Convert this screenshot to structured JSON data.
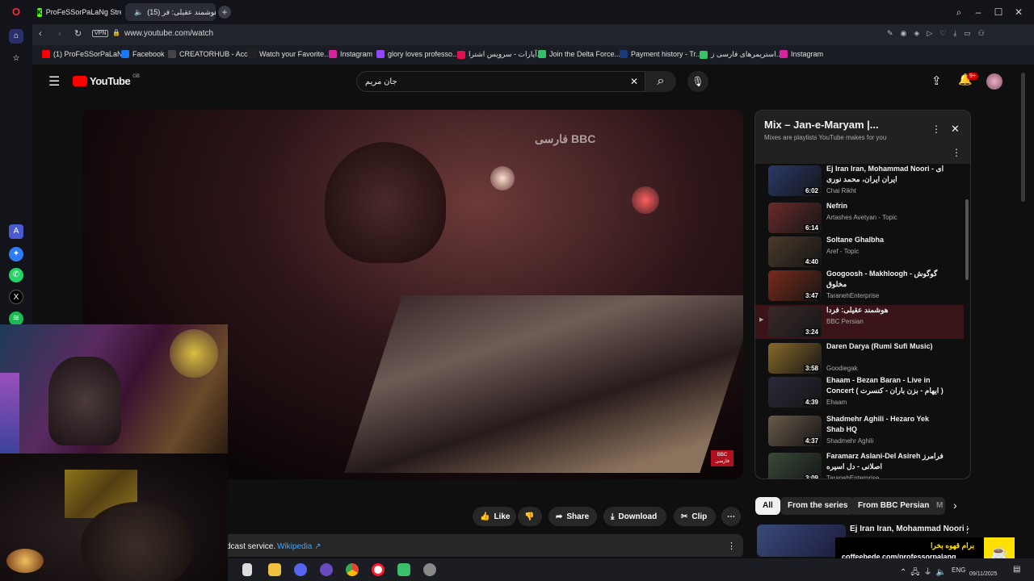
{
  "browser": {
    "tabs": [
      {
        "label": "ProFeSSorPaLaNg Stream"
      },
      {
        "label": "(15) هوشمند عقیلی: فر"
      }
    ],
    "vpn_label": "VPN",
    "url": "www.youtube.com/watch",
    "bookmarks": [
      {
        "label": "(1) ProFeSSorPaLaN..."
      },
      {
        "label": "Facebook"
      },
      {
        "label": "CREATORHUB - Acc..."
      },
      {
        "label": "Watch your Favorite..."
      },
      {
        "label": "Instagram"
      },
      {
        "label": "glory loves professo..."
      },
      {
        "label": "آپارات - سرویس اشترا..."
      },
      {
        "label": "Join the Delta Force..."
      },
      {
        "label": "Payment history - Tr..."
      },
      {
        "label": "استریمرهای فارسی ز..."
      },
      {
        "label": "Instagram"
      }
    ]
  },
  "youtube": {
    "logo_text": "YouTube",
    "region": "GB",
    "search_value": "جان مریم",
    "notif_count": "9+",
    "video": {
      "watermark": "فارسی BBC",
      "corner_badge": "BBC فارسی"
    },
    "playlist": {
      "title": "Mix – Jan-e-Maryam |...",
      "subtitle": "Mixes are playlists YouTube makes for you",
      "items": [
        {
          "title": "Ej Iran Iran, Mohammad Noori - ای ایران ایران، محمد نوری",
          "channel": "Chai Rikht",
          "duration": "6:02"
        },
        {
          "title": "Nefrin",
          "channel": "Artashes Avetyan - Topic",
          "duration": "6:14"
        },
        {
          "title": "Soltane Ghalbha",
          "channel": "Aref - Topic",
          "duration": "4:40"
        },
        {
          "title": "Googoosh - Makhloogh - گوگوش مخلوق",
          "channel": "TaranehEnterprise",
          "duration": "3:47"
        },
        {
          "title": "هوشمند عقیلی: فردا",
          "channel": "BBC Persian",
          "duration": "3:24",
          "active": true
        },
        {
          "title": "Daren Darya (Rumi Sufi Music)",
          "channel": "Goodiegak",
          "duration": "3:58"
        },
        {
          "title": "Ehaam - Bezan Baran - Live in Concert ( ایهام - بزن باران - کنسرت )",
          "channel": "Ehaam",
          "duration": "4:39"
        },
        {
          "title": "Shadmehr Aghili - Hezaro Yek Shab HQ",
          "channel": "Shadmehr Aghili",
          "duration": "4:37"
        },
        {
          "title": "Faramarz Aslani-Del Asireh فرامرز اصلانی - دل اسیره",
          "channel": "TaranehEnterprise",
          "duration": "3:09"
        }
      ]
    },
    "actions": {
      "like": "Like",
      "share": "Share",
      "download": "Download",
      "clip": "Clip"
    },
    "description_tail": "dcast service.",
    "wikipedia_link": "Wikipedia",
    "chips": [
      "All",
      "From the series",
      "From BBC Persian",
      "M"
    ],
    "recommended": {
      "title": "Ej Iran Iran, Mohammad Noori -"
    }
  },
  "overlay": {
    "coffee_persian": "برام قهوه بخرا",
    "coffee_url": "coffeebede.com/professorpalang"
  },
  "taskbar": {
    "lang": "ENG",
    "date": "09/11/2025"
  }
}
